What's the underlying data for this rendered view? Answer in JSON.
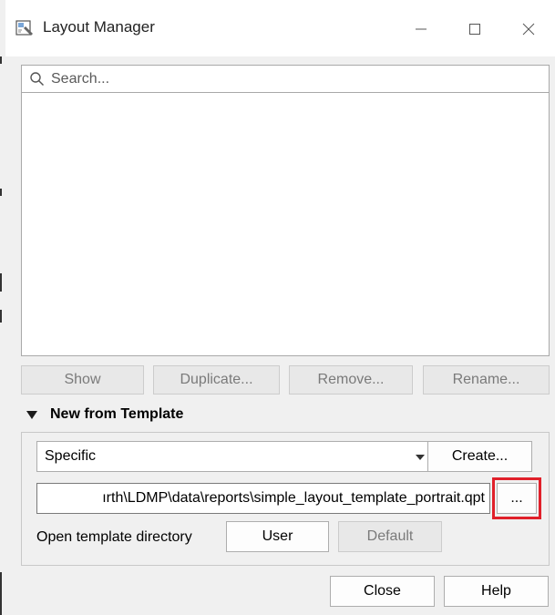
{
  "window": {
    "title": "Layout Manager",
    "icon": "layout-manager-icon",
    "controls": {
      "minimize": "minimize-icon",
      "maximize": "maximize-icon",
      "close": "close-x-icon"
    }
  },
  "search": {
    "placeholder": "Search..."
  },
  "layout_list": {
    "items": []
  },
  "list_buttons": {
    "show": "Show",
    "duplicate": "Duplicate...",
    "remove": "Remove...",
    "rename": "Rename..."
  },
  "template_section": {
    "header": "New from Template",
    "expanded": true,
    "template_type": {
      "selected": "Specific"
    },
    "create_button": "Create...",
    "template_path": "ırth\\LDMP\\data\\reports\\simple_layout_template_portrait.qpt",
    "browse_button": "...",
    "open_dir_label": "Open template directory",
    "user_button": "User",
    "default_button": "Default"
  },
  "footer": {
    "close_button": "Close",
    "help_button": "Help"
  },
  "colors": {
    "highlight": "#e0202a",
    "dialog_background": "#f0f0f0"
  }
}
